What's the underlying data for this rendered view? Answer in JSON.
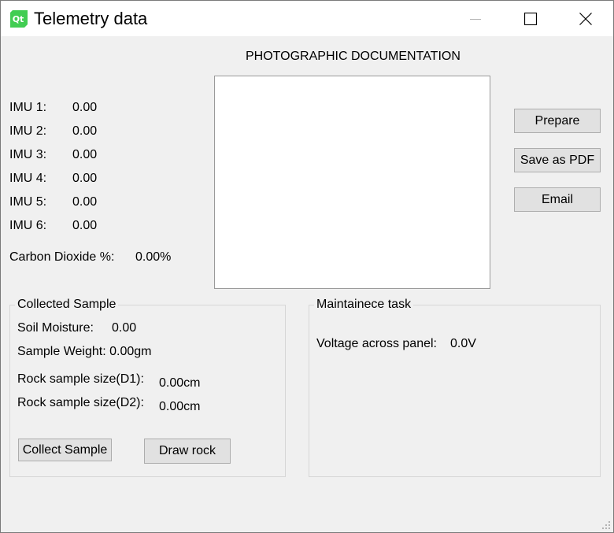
{
  "window": {
    "title": "Telemetry data",
    "app_icon": "qt-logo-icon",
    "controls": [
      "minimize-icon",
      "maximize-icon",
      "close-icon"
    ]
  },
  "photo": {
    "heading": "PHOTOGRAPHIC DOCUMENTATION"
  },
  "imu": [
    {
      "label": "IMU 1:",
      "value": "0.00"
    },
    {
      "label": "IMU 2:",
      "value": "0.00"
    },
    {
      "label": "IMU 3:",
      "value": "0.00"
    },
    {
      "label": "IMU 4:",
      "value": "0.00"
    },
    {
      "label": "IMU 5:",
      "value": "0.00"
    },
    {
      "label": "IMU 6:",
      "value": "0.00"
    }
  ],
  "co2": {
    "label": "Carbon Dioxide %:",
    "value": "0.00%"
  },
  "actions": {
    "prepare": "Prepare",
    "save_pdf": "Save as PDF",
    "email": "Email"
  },
  "collected_sample": {
    "title": "Collected Sample",
    "soil_moisture_label": "Soil Moisture:",
    "soil_moisture_value": "0.00",
    "sample_weight": "Sample Weight: 0.00gm",
    "rock_d1_label": "Rock sample size(D1):",
    "rock_d1_value": "0.00cm",
    "rock_d2_label": "Rock sample size(D2):",
    "rock_d2_value": "0.00cm",
    "collect_button": "Collect Sample",
    "draw_button": "Draw rock"
  },
  "maintenance": {
    "title": "Maintainece task",
    "voltage_label": "Voltage across panel:",
    "voltage_value": "0.0V"
  }
}
